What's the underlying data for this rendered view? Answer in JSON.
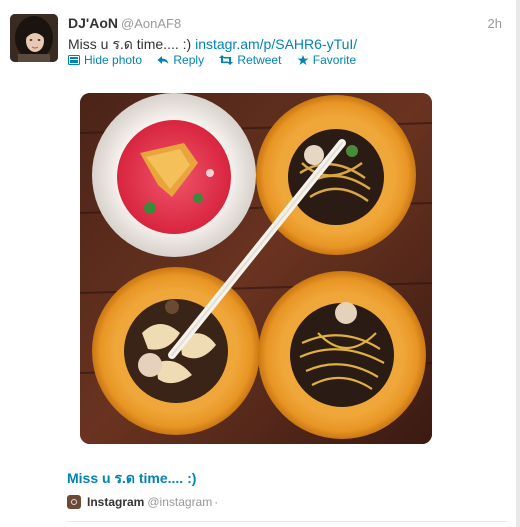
{
  "tweet": {
    "fullname": "DJ'AoN",
    "username": "@AonAF8",
    "time": "2h",
    "text": "Miss u ร.ด time.... :)",
    "link": "instagr.am/p/SAHR6-yTuI/",
    "actions": {
      "hide_photo": "Hide photo",
      "reply": "Reply",
      "retweet": "Retweet",
      "favorite": "Favorite"
    }
  },
  "media": {
    "caption": "Miss u ร.ด time.... :)",
    "source_name": "Instagram",
    "source_handle": "@instagram",
    "separator": "·"
  },
  "colors": {
    "link": "#0084b4",
    "muted": "#999999",
    "text": "#333333"
  }
}
